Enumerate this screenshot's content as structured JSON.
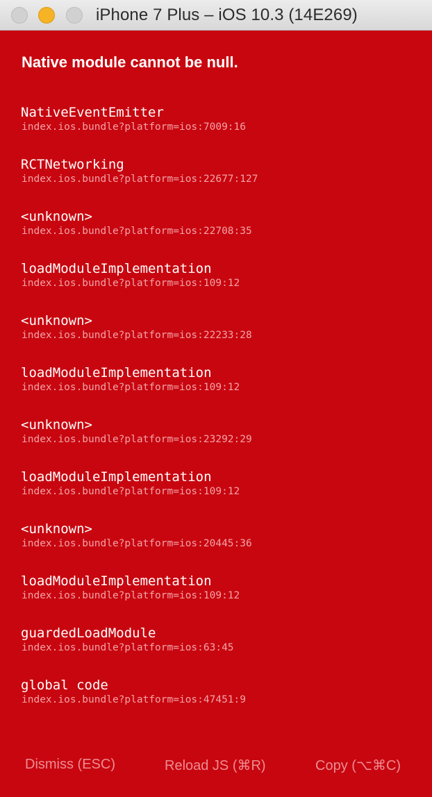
{
  "window": {
    "title": "iPhone 7 Plus – iOS 10.3 (14E269)"
  },
  "colors": {
    "background": "#c8060f",
    "message": "#ffffff",
    "file": "#f3a3a9",
    "action": "#ee8c93"
  },
  "redbox": {
    "message": "Native module cannot be null.",
    "stack": [
      {
        "method": "NativeEventEmitter",
        "file": "index.ios.bundle?platform=ios:7009:16"
      },
      {
        "method": "RCTNetworking",
        "file": "index.ios.bundle?platform=ios:22677:127"
      },
      {
        "method": "<unknown>",
        "file": "index.ios.bundle?platform=ios:22708:35"
      },
      {
        "method": "loadModuleImplementation",
        "file": "index.ios.bundle?platform=ios:109:12"
      },
      {
        "method": "<unknown>",
        "file": "index.ios.bundle?platform=ios:22233:28"
      },
      {
        "method": "loadModuleImplementation",
        "file": "index.ios.bundle?platform=ios:109:12"
      },
      {
        "method": "<unknown>",
        "file": "index.ios.bundle?platform=ios:23292:29"
      },
      {
        "method": "loadModuleImplementation",
        "file": "index.ios.bundle?platform=ios:109:12"
      },
      {
        "method": "<unknown>",
        "file": "index.ios.bundle?platform=ios:20445:36"
      },
      {
        "method": "loadModuleImplementation",
        "file": "index.ios.bundle?platform=ios:109:12"
      },
      {
        "method": "guardedLoadModule",
        "file": "index.ios.bundle?platform=ios:63:45"
      },
      {
        "method": "global code",
        "file": "index.ios.bundle?platform=ios:47451:9"
      }
    ],
    "actions": {
      "dismiss": "Dismiss (ESC)",
      "reload": "Reload JS (⌘R)",
      "copy": "Copy (⌥⌘C)"
    }
  }
}
